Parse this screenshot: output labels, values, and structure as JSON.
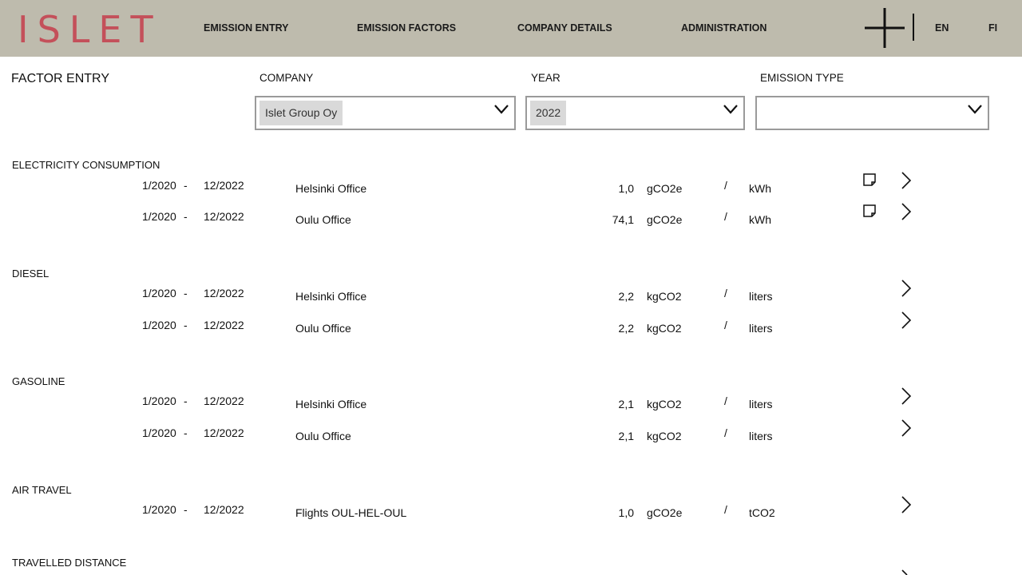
{
  "header": {
    "logo": "ISLET",
    "nav": [
      "EMISSION ENTRY",
      "EMISSION FACTORS",
      "COMPANY DETAILS",
      "ADMINISTRATION"
    ],
    "add_icon": "plus-icon",
    "languages": [
      "EN",
      "FI"
    ]
  },
  "page": {
    "title": "FACTOR ENTRY"
  },
  "filters": {
    "company": {
      "label": "COMPANY",
      "value": "Islet Group Oy"
    },
    "year": {
      "label": "YEAR",
      "value": "2022"
    },
    "emission_type": {
      "label": "EMISSION TYPE",
      "value": ""
    }
  },
  "sections": [
    {
      "title": "ELECTRICITY CONSUMPTION",
      "rows": [
        {
          "start": "1/2020",
          "end": "12/2022",
          "location": "Helsinki Office",
          "value": "1,0",
          "unit": "gCO2e",
          "per": "kWh",
          "has_note": true
        },
        {
          "start": "1/2020",
          "end": "12/2022",
          "location": "Oulu Office",
          "value": "74,1",
          "unit": "gCO2e",
          "per": "kWh",
          "has_note": true
        }
      ]
    },
    {
      "title": "DIESEL",
      "rows": [
        {
          "start": "1/2020",
          "end": "12/2022",
          "location": "Helsinki Office",
          "value": "2,2",
          "unit": "kgCO2",
          "per": "liters",
          "has_note": false
        },
        {
          "start": "1/2020",
          "end": "12/2022",
          "location": "Oulu Office",
          "value": "2,2",
          "unit": "kgCO2",
          "per": "liters",
          "has_note": false
        }
      ]
    },
    {
      "title": "GASOLINE",
      "rows": [
        {
          "start": "1/2020",
          "end": "12/2022",
          "location": "Helsinki Office",
          "value": "2,1",
          "unit": "kgCO2",
          "per": "liters",
          "has_note": false
        },
        {
          "start": "1/2020",
          "end": "12/2022",
          "location": "Oulu Office",
          "value": "2,1",
          "unit": "kgCO2",
          "per": "liters",
          "has_note": false
        }
      ]
    },
    {
      "title": "AIR TRAVEL",
      "rows": [
        {
          "start": "1/2020",
          "end": "12/2022",
          "location": "Flights OUL-HEL-OUL",
          "value": "1,0",
          "unit": "gCO2e",
          "per": "tCO2",
          "has_note": false
        }
      ]
    },
    {
      "title": "TRAVELLED DISTANCE",
      "rows": []
    }
  ],
  "separators": {
    "range_dash": "-",
    "per_slash": "/"
  },
  "colors": {
    "header_bg": "#bebbad",
    "logo": "#c4505a",
    "chip_bg": "#d9d9d9",
    "select_border": "#9a9a9a"
  }
}
